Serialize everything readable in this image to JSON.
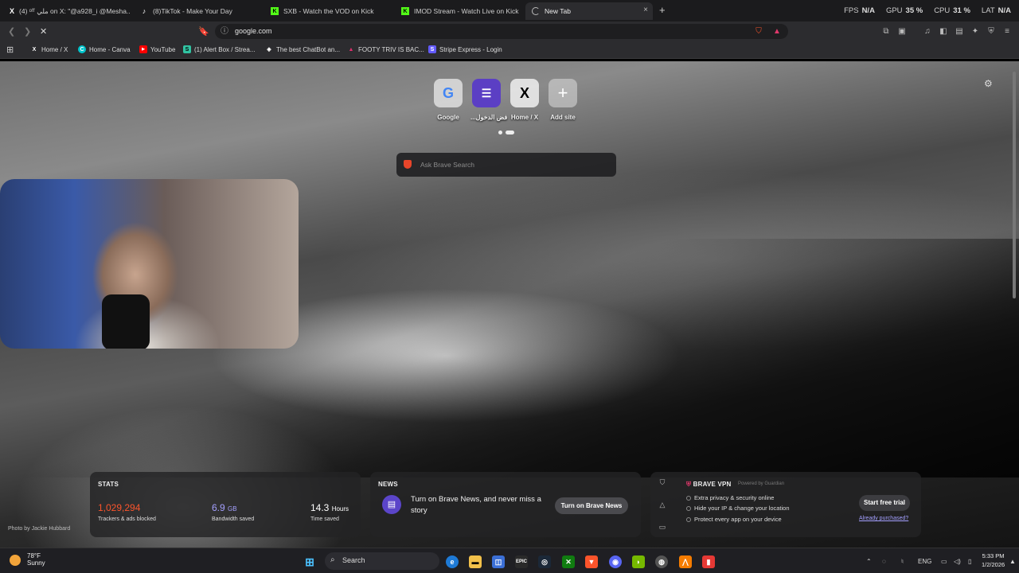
{
  "tabs": [
    {
      "title": "(4) ᵒᶠᶠ ملي on X: \"@a928_i @Mesha...",
      "icon": "x-logo-icon"
    },
    {
      "title": "(8)TikTok - Make Your Day",
      "icon": "tiktok-icon"
    },
    {
      "title": "SXB - Watch the VOD on Kick",
      "icon": "kick-icon"
    },
    {
      "title": "IMOD Stream - Watch Live on Kick",
      "icon": "kick-icon"
    },
    {
      "title": "New Tab",
      "icon": "loading-spinner-icon",
      "close": "×"
    }
  ],
  "new_tab_symbol": "+",
  "overlay": {
    "fps_label": "FPS",
    "fps_value": "N/A",
    "gpu_label": "GPU",
    "gpu_value": "35 %",
    "cpu_label": "CPU",
    "cpu_value": "31 %",
    "lat_label": "LAT",
    "lat_value": "N/A"
  },
  "address": {
    "url": "google.com"
  },
  "bookmarks": [
    {
      "label": "Home / X",
      "color": "#000000"
    },
    {
      "label": "Home - Canva",
      "color": "#00c4cc"
    },
    {
      "label": "YouTube",
      "color": "#ff0000"
    },
    {
      "label": "(1) Alert Box / Strea...",
      "color": "#31c3a2"
    },
    {
      "label": "The best ChatBot an...",
      "color": "#ffffff"
    },
    {
      "label": "FOOTY TRIV IS BAC...",
      "color": "#e02f6e"
    },
    {
      "label": "Stripe Express - Login",
      "color": "#635bff"
    }
  ],
  "top_sites": [
    {
      "label": "Google",
      "icon": "google-icon"
    },
    {
      "label": "...فض الدخول",
      "icon": "list-icon"
    },
    {
      "label": "Home / X",
      "icon": "x-logo-icon"
    },
    {
      "label": "Add site",
      "icon": "plus-icon"
    }
  ],
  "search": {
    "placeholder": "Ask Brave Search"
  },
  "stats": {
    "title": "STATS",
    "trackers_value": "1,029,294",
    "trackers_label": "Trackers & ads blocked",
    "bandwidth_value": "6.9",
    "bandwidth_unit": "GB",
    "bandwidth_label": "Bandwidth saved",
    "time_value": "14.3",
    "time_unit": "Hours",
    "time_label": "Time saved"
  },
  "news": {
    "title": "NEWS",
    "text": "Turn on Brave News, and never miss a story",
    "button": "Turn on Brave News"
  },
  "vpn": {
    "title": "BRAVE VPN",
    "powered": "Powered by Guardian",
    "features": [
      "Extra privacy & security online",
      "Hide your IP & change your location",
      "Protect every app on your device"
    ],
    "button": "Start free trial",
    "link": "Already purchased?"
  },
  "photo_credit": "Photo by Jackie Hubbard",
  "taskbar": {
    "weather_temp": "78°F",
    "weather_desc": "Sunny",
    "search_label": "Search",
    "language": "ENG",
    "time": "5:33 PM",
    "date": "1/2/2026"
  },
  "colors": {
    "brave_orange": "#fb542b",
    "kick_green": "#53fc18",
    "news_purple": "#5b45c9"
  }
}
